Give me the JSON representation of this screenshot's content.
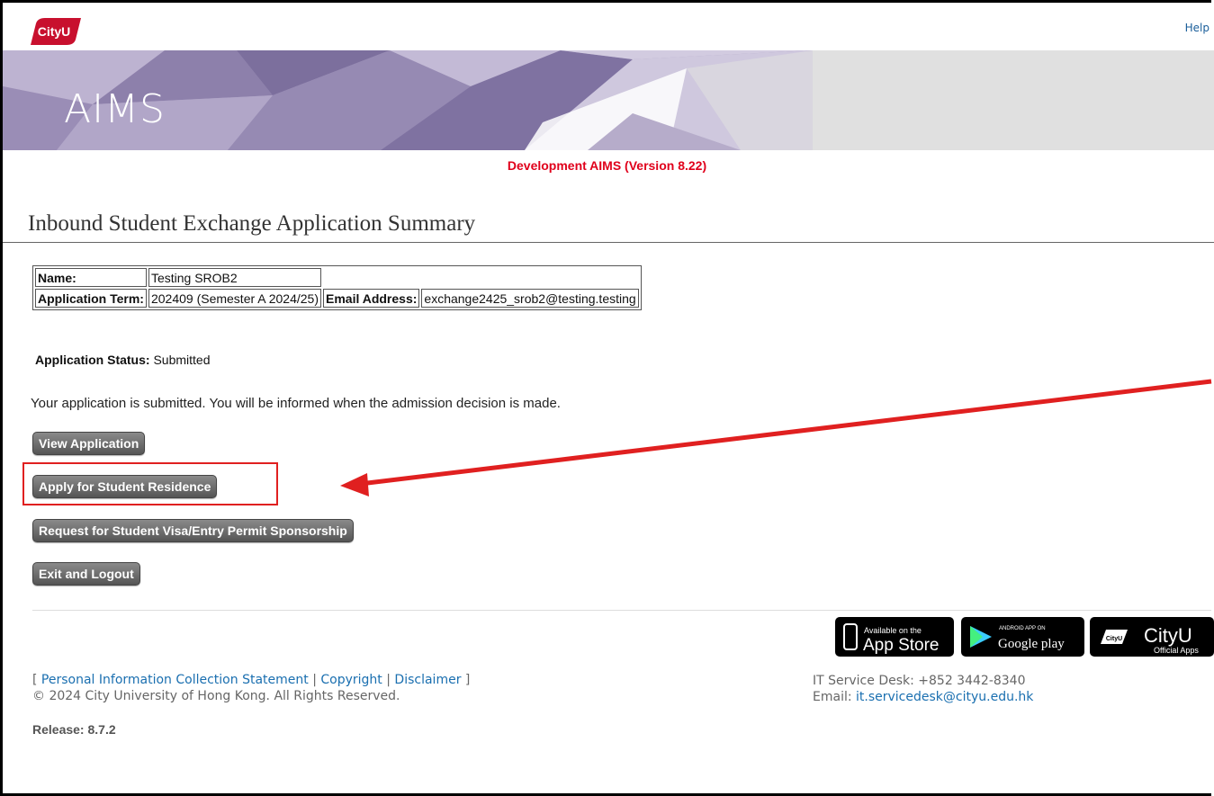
{
  "header": {
    "logo_text": "CityU",
    "help_label": "Help",
    "banner_title": "AIMS",
    "dev_version": "Development AIMS (Version 8.22)"
  },
  "page": {
    "title": "Inbound Student Exchange Application Summary"
  },
  "applicant": {
    "name_label": "Name:",
    "name_value": "Testing SROB2",
    "term_label": "Application Term:",
    "term_value": "202409 (Semester A 2024/25)",
    "email_label": "Email Address:",
    "email_value": "exchange2425_srob2@testing.testing"
  },
  "status": {
    "label": "Application Status:",
    "value": "Submitted",
    "message": "Your application is submitted. You will be informed when the admission decision is made."
  },
  "actions": {
    "view_application": "View Application",
    "apply_residence": "Apply for Student Residence",
    "request_visa": "Request for Student Visa/Entry Permit Sponsorship",
    "exit_logout": "Exit and Logout"
  },
  "annotation": {
    "highlight_color": "#e02020"
  },
  "footer": {
    "link_open": "[",
    "links": [
      "Personal Information Collection Statement",
      "Copyright",
      "Disclaimer"
    ],
    "separator": "|",
    "link_close": "]",
    "copyright": "© 2024 City University of Hong Kong. All Rights Reserved.",
    "release": "Release: 8.7.2",
    "service_desk": "IT Service Desk: +852 3442-8340",
    "email_label": "Email:",
    "email_value": "it.servicedesk@cityu.edu.hk",
    "badges": {
      "appstore_small": "Available on the",
      "appstore_big": "App Store",
      "google_small": "ANDROID APP ON",
      "google_big": "Google play",
      "cityu_logo": "CityU",
      "cityu_big": "CityU",
      "cityu_small": "Official Apps"
    }
  },
  "colors": {
    "brand_red": "#c8102e",
    "dev_red": "#e0001b",
    "link_blue": "#1a6fb0",
    "button_gray": "#666666"
  }
}
